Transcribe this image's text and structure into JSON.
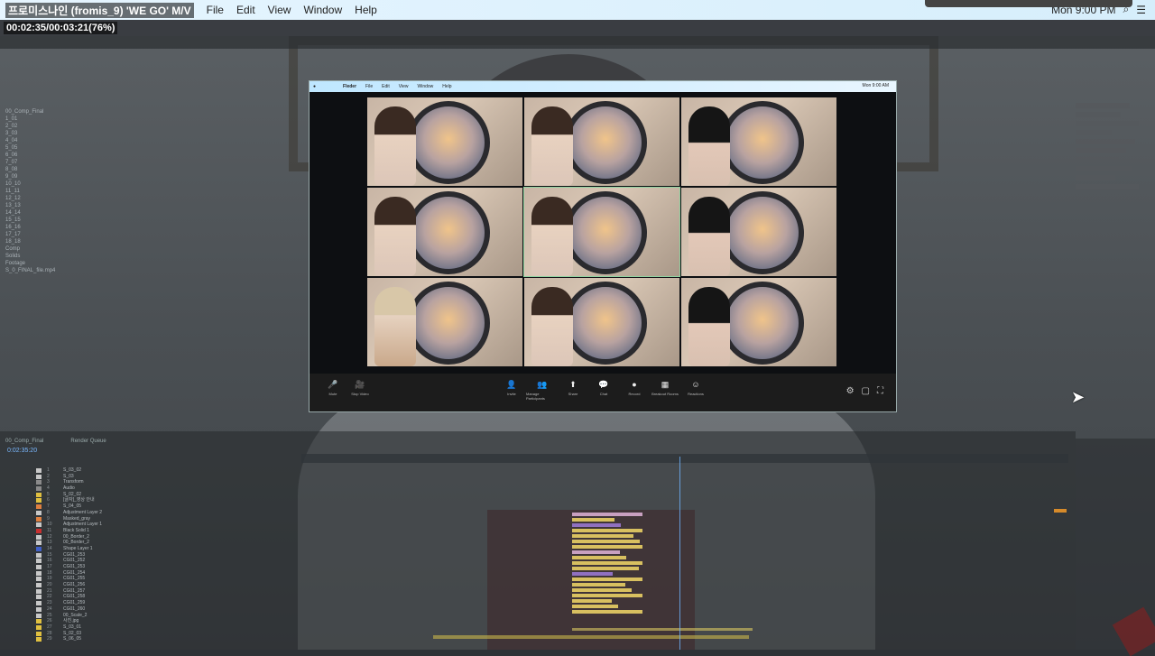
{
  "video_overlay": {
    "title": "프로미스나인 (fromis_9) 'WE GO' M/V",
    "timecode": "00:02:35/00:03:21(76%)"
  },
  "menubar": {
    "items": [
      "File",
      "Edit",
      "View",
      "Window",
      "Help"
    ],
    "clock": "Mon 9:00 PM"
  },
  "zoom": {
    "menubar": {
      "app_name": "Fleder",
      "items": [
        "File",
        "Edit",
        "View",
        "Window",
        "Help"
      ],
      "clock": "Mon 9:00 AM"
    },
    "controls": [
      {
        "icon": "🎤",
        "label": "Mute"
      },
      {
        "icon": "🎥",
        "label": "Stop Video"
      },
      {
        "icon": "👤",
        "label": "Invite"
      },
      {
        "icon": "👥",
        "label": "Manage Participants"
      },
      {
        "icon": "⬆",
        "label": "Share"
      },
      {
        "icon": "💬",
        "label": "Chat"
      },
      {
        "icon": "●",
        "label": "Record"
      },
      {
        "icon": "▦",
        "label": "Breakout Rooms"
      },
      {
        "icon": "☺",
        "label": "Reactions"
      }
    ]
  },
  "project_tree": [
    "00_Comp_Final",
    "1_01",
    "2_02",
    "3_03",
    "4_04",
    "5_05",
    "6_06",
    "7_07",
    "8_08",
    "9_09",
    "10_10",
    "11_11",
    "12_12",
    "13_13",
    "14_14",
    "15_15",
    "16_16",
    "17_17",
    "18_18",
    "Comp",
    "Solids",
    "Footage",
    "S_0_FINAL_file.mp4"
  ],
  "timeline": {
    "tabs": [
      "00_Comp_Final",
      "Render Queue"
    ],
    "current_time": "0:02:35:20",
    "layers": [
      {
        "num": "1",
        "name": "S_03_02",
        "color": "#c8c8c8"
      },
      {
        "num": "2",
        "name": "S_03",
        "color": "#c8c8c8"
      },
      {
        "num": "3",
        "name": "Transform",
        "color": "#8a8a8a"
      },
      {
        "num": "4",
        "name": "Audio",
        "color": "#8a8a8a"
      },
      {
        "num": "5",
        "name": "S_02_02",
        "color": "#e0c040"
      },
      {
        "num": "6",
        "name": "[글자]_영상 안내",
        "color": "#e0c040"
      },
      {
        "num": "7",
        "name": "S_04_05",
        "color": "#e08040"
      },
      {
        "num": "8",
        "name": "Adjustment Layer 2",
        "color": "#c8c8c8"
      },
      {
        "num": "9",
        "name": "Masked_gray",
        "color": "#e08040"
      },
      {
        "num": "10",
        "name": "Adjustment Layer 1",
        "color": "#c8c8c8"
      },
      {
        "num": "11",
        "name": "Black Solid 1",
        "color": "#c83030"
      },
      {
        "num": "12",
        "name": "00_Border_2",
        "color": "#c8c8c8"
      },
      {
        "num": "13",
        "name": "00_Border_2",
        "color": "#c8c8c8"
      },
      {
        "num": "14",
        "name": "Shape Layer 1",
        "color": "#4060c8"
      },
      {
        "num": "15",
        "name": "CG01_253",
        "color": "#c8c8c8"
      },
      {
        "num": "16",
        "name": "CG01_252",
        "color": "#c8c8c8"
      },
      {
        "num": "17",
        "name": "CG01_253",
        "color": "#c8c8c8"
      },
      {
        "num": "18",
        "name": "CG01_254",
        "color": "#c8c8c8"
      },
      {
        "num": "19",
        "name": "CG01_255",
        "color": "#c8c8c8"
      },
      {
        "num": "20",
        "name": "CG01_256",
        "color": "#c8c8c8"
      },
      {
        "num": "21",
        "name": "CG01_257",
        "color": "#c8c8c8"
      },
      {
        "num": "22",
        "name": "CG01_258",
        "color": "#c8c8c8"
      },
      {
        "num": "23",
        "name": "CG01_259",
        "color": "#c8c8c8"
      },
      {
        "num": "24",
        "name": "CG01_260",
        "color": "#c8c8c8"
      },
      {
        "num": "25",
        "name": "00_Scale_2",
        "color": "#c8c8c8"
      },
      {
        "num": "26",
        "name": "사진.jpg",
        "color": "#e0c040"
      },
      {
        "num": "27",
        "name": "S_03_01",
        "color": "#e0c040"
      },
      {
        "num": "28",
        "name": "S_02_03",
        "color": "#e0c040"
      },
      {
        "num": "29",
        "name": "S_06_05",
        "color": "#e0c040"
      }
    ],
    "bar_colors": [
      "#c8a0c0",
      "#d8c060",
      "#9070c0",
      "#d8c060",
      "#d8c060",
      "#d8c060",
      "#d8c060",
      "#c8a0c0",
      "#d8c060",
      "#d8c060",
      "#d8c060",
      "#9070c0",
      "#d8c060",
      "#d8c060",
      "#d8c060",
      "#d8c060",
      "#d8c060",
      "#d8c060",
      "#d8c060"
    ]
  },
  "colors": {
    "accent": "#6fb4ff",
    "menubar_bg": "#e6f5ff"
  }
}
